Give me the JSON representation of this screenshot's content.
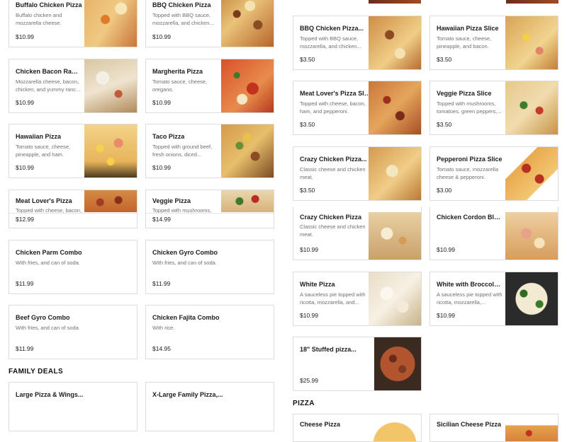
{
  "left_column": {
    "items": [
      {
        "name": "Buffalo Chicken Pizza",
        "desc": "Buffalo chicken and mozzarella cheese.",
        "price": "$10.99",
        "image": "buffalo-chicken-pizza-photo"
      },
      {
        "name": "BBQ Chicken Pizza",
        "desc": "Topped with BBQ sauce, mozzarella, and chicken...",
        "price": "$10.99",
        "image": "bbq-chicken-pizza-photo"
      },
      {
        "name": "Chicken Bacon Ranch...",
        "desc": "Mozzarella cheese, bacon, chicken, and yummy ranc...",
        "price": "$10.99",
        "image": "chicken-bacon-ranch-photo"
      },
      {
        "name": "Margherita Pizza",
        "desc": "Tomato sauce, cheese, oregano.",
        "price": "$10.99",
        "image": "margherita-pizza-photo"
      },
      {
        "name": "Hawaiian Pizza",
        "desc": "Tomato sauce, cheese, pineapple, and ham.",
        "price": "$10.99",
        "image": "hawaiian-pizza-photo"
      },
      {
        "name": "Taco Pizza",
        "desc": "Topped with ground beef, fresh onions, diced...",
        "price": "$10.99",
        "image": "taco-pizza-photo"
      },
      {
        "name": "Meat Lover's Pizza",
        "desc": "Topped with cheese, bacon,",
        "price": "$12.99",
        "image": "meat-lovers-pizza-photo"
      },
      {
        "name": "Veggie Pizza",
        "desc": "Topped with mushrooms,",
        "price": "$14.99",
        "image": "veggie-pizza-photo"
      },
      {
        "name": "Chicken Parm Combo",
        "desc": "With fries, and can of soda.",
        "price": "$11.99"
      },
      {
        "name": "Chicken Gyro Combo",
        "desc": "With fries, and can of soda.",
        "price": "$11.99"
      },
      {
        "name": "Beef Gyro Combo",
        "desc": "With fries, and can of soda.",
        "price": "$11.99"
      },
      {
        "name": "Chicken Fajita Combo",
        "desc": "With rice.",
        "price": "$14.95"
      }
    ],
    "family_deals_title": "FAMILY DEALS",
    "family_deals": [
      {
        "name": "Large Pizza & Wings..."
      },
      {
        "name": "X-Large Family Pizza,..."
      }
    ]
  },
  "right_column": {
    "slices": [
      {
        "name": "BBQ Chicken Pizza...",
        "desc": "Topped with BBQ sauce, mozzarella, and chicken...",
        "price": "$3.50",
        "image": "bbq-chicken-slice-photo"
      },
      {
        "name": "Hawaiian Pizza Slice",
        "desc": "Tomato sauce, cheese, pineapple, and bacon.",
        "price": "$3.50",
        "image": "hawaiian-slice-photo"
      },
      {
        "name": "Meat Lover's Pizza Slice",
        "desc": "Topped with cheese, bacon, ham, and pepperoni.",
        "price": "$3.50",
        "image": "meat-lovers-slice-photo"
      },
      {
        "name": "Veggie Pizza Slice",
        "desc": "Topped with mushrooms, tomatoes, green peppers,...",
        "price": "$3.50",
        "image": "veggie-slice-photo"
      },
      {
        "name": "Crazy Chicken Pizza...",
        "desc": "Classic cheese and chicken meat.",
        "price": "$3.50",
        "image": "crazy-chicken-slice-photo"
      },
      {
        "name": "Pepperoni Pizza Slice",
        "desc": "Tomato sauce, mozzarella cheese & pepperoni.",
        "price": "$3.00",
        "image": "pepperoni-slice-photo"
      }
    ],
    "specialty": [
      {
        "name": "Crazy Chicken Pizza",
        "desc": "Classic cheese and chicken meat.",
        "price": "$10.99",
        "image": "crazy-chicken-pizza-photo"
      },
      {
        "name": "Chicken Cordon Blue...",
        "desc": "",
        "price": "$10.99",
        "image": "chicken-cordon-blue-photo"
      },
      {
        "name": "White Pizza",
        "desc": "A sauceless pie topped with ricotta, mozzarella, and...",
        "price": "$10.99",
        "image": "white-pizza-photo"
      },
      {
        "name": "White with Broccoli &...",
        "desc": "A sauceless pie topped with ricotta, mozzarella,...",
        "price": "$10.99",
        "image": "white-broccoli-pizza-photo"
      },
      {
        "name": "18\" Stuffed pizza...",
        "desc": "",
        "price": "$25.99",
        "image": "stuffed-pizza-photo"
      }
    ],
    "pizza_title": "PIZZA",
    "pizza": [
      {
        "name": "Cheese Pizza",
        "image": "cheese-pizza-photo"
      },
      {
        "name": "Sicilian Cheese Pizza",
        "image": "sicilian-cheese-pizza-photo"
      }
    ]
  }
}
